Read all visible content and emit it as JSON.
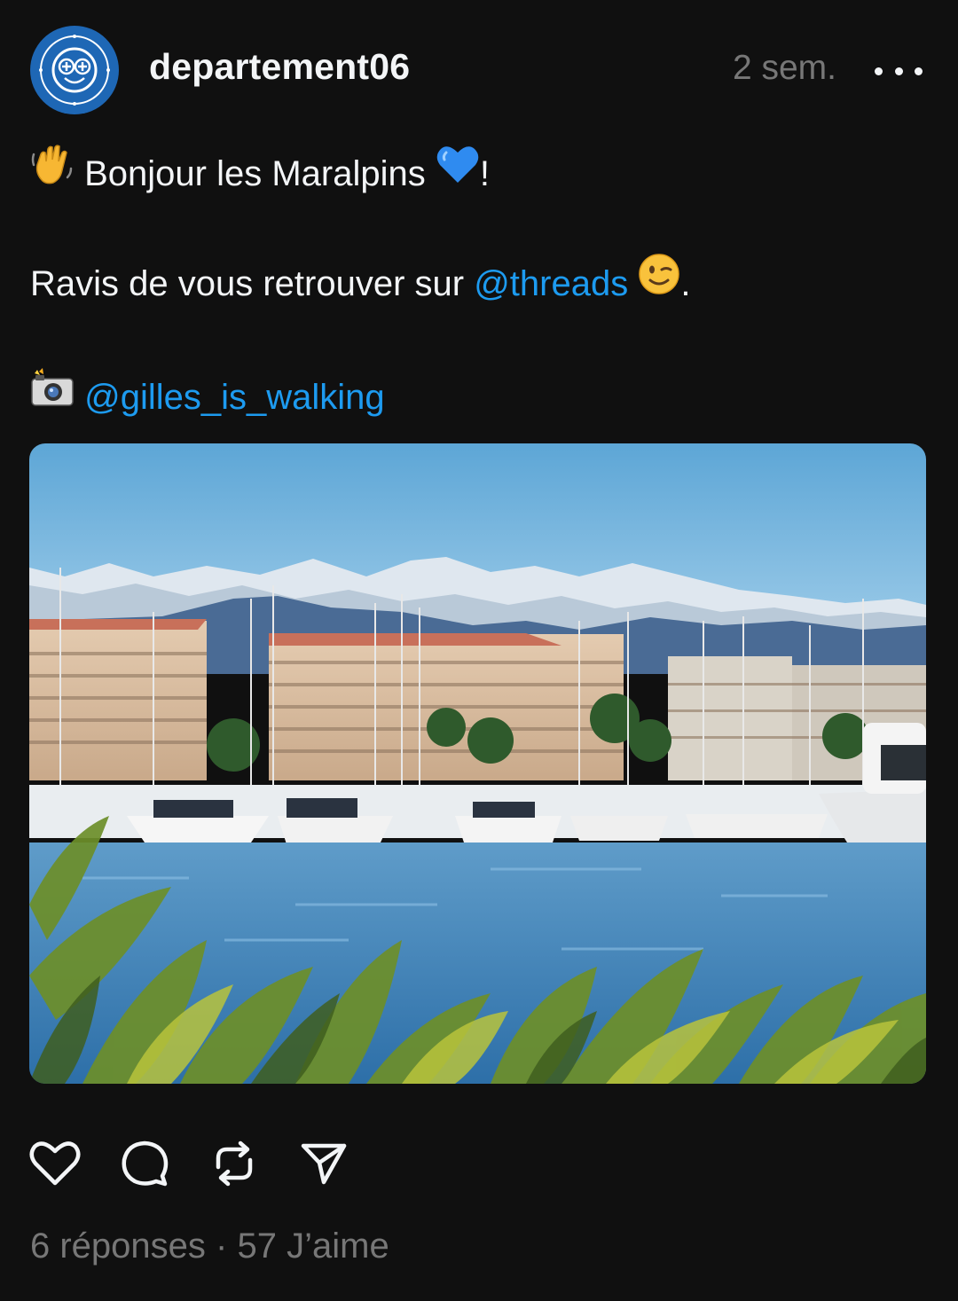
{
  "post": {
    "author": "departement06",
    "time_ago": "2 sem.",
    "avatar_icon": "departement-alpes-maritimes-logo",
    "greeting": "Bonjour les Maralpins",
    "greeting_suffix": "!",
    "line2_text": "Ravis de vous retrouver sur ",
    "line2_mention": "@threads",
    "line2_suffix": ".",
    "credit_mention": "@gilles_is_walking",
    "photo_alt": "Port de plaisance avec montagnes enneigées",
    "replies": "6 réponses",
    "separator": "·",
    "likes": "57 J’aime"
  },
  "colors": {
    "background": "#101010",
    "text": "#f3f5f7",
    "muted": "#777777",
    "link": "#1d9bf0",
    "avatar_blue": "#1e67b5"
  },
  "icons": {
    "more": "more-horizontal-icon",
    "like": "heart-icon",
    "reply": "comment-icon",
    "repost": "repost-icon",
    "share": "send-icon"
  }
}
